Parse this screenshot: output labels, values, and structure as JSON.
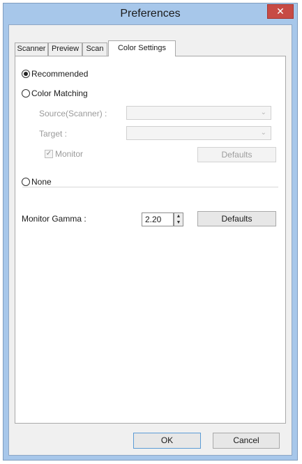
{
  "window": {
    "title": "Preferences",
    "close_glyph": "✕"
  },
  "tabs": [
    {
      "label": "Scanner"
    },
    {
      "label": "Preview"
    },
    {
      "label": "Scan"
    },
    {
      "label": "Color Settings"
    }
  ],
  "active_tab": "Color Settings",
  "color": {
    "recommended_label": "Recommended",
    "color_matching_label": "Color Matching",
    "source_label": "Source(Scanner) :",
    "source_value": "",
    "target_label": "Target :",
    "target_value": "",
    "monitor_label": "Monitor",
    "monitor_checked": true,
    "defaults_label": "Defaults",
    "none_label": "None",
    "selected_option": "Recommended"
  },
  "gamma": {
    "label": "Monitor Gamma :",
    "value": "2.20",
    "defaults_label": "Defaults"
  },
  "footer": {
    "ok_label": "OK",
    "cancel_label": "Cancel"
  },
  "icons": {
    "chevron": "chevron-down-icon",
    "spin_up": "▲",
    "spin_down": "▼"
  },
  "colors": {
    "titlebar": "#a7c7ea",
    "close": "#c74b45",
    "focus": "#5b9bd5"
  }
}
